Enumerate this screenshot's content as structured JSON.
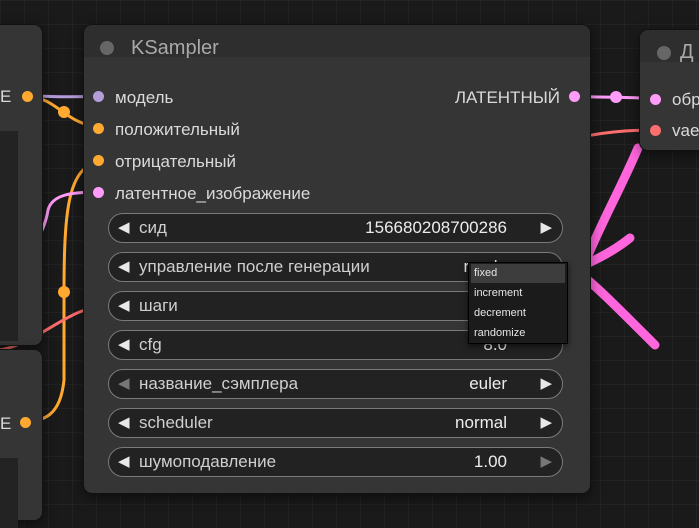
{
  "colors": {
    "canvas": "#1a1a1a",
    "model": "#b39ddb",
    "conditioning": "#ffa931",
    "latent": "#ff9cf9",
    "vae": "#ff6e6e",
    "annotation": "#ff66dd"
  },
  "left_nodes": {
    "top_output_suffix": "E",
    "bottom_output_suffix": "E"
  },
  "ksampler": {
    "title": "KSampler",
    "inputs": [
      {
        "name": "модель",
        "type": "MODEL"
      },
      {
        "name": "положительный",
        "type": "CONDITIONING"
      },
      {
        "name": "отрицательный",
        "type": "CONDITIONING"
      },
      {
        "name": "латентное_изображение",
        "type": "LATENT"
      }
    ],
    "output": {
      "name": "ЛАТЕНТНЫЙ",
      "type": "LATENT"
    },
    "widgets": [
      {
        "label": "сид",
        "value": "156680208700286"
      },
      {
        "label": "управление после генерации",
        "value": "rando"
      },
      {
        "label": "шаги",
        "value": ""
      },
      {
        "label": "cfg",
        "value": "8.0"
      },
      {
        "label": "название_сэмплера",
        "value": "euler"
      },
      {
        "label": "scheduler",
        "value": "normal"
      },
      {
        "label": "шумоподавление",
        "value": "1.00"
      }
    ]
  },
  "right_node": {
    "title": "Д",
    "inputs": [
      {
        "name": "обр",
        "type": "LATENT"
      },
      {
        "name": "vae",
        "type": "VAE"
      }
    ]
  },
  "dropdown": {
    "options": [
      "fixed",
      "increment",
      "decrement",
      "randomize"
    ],
    "selected": "fixed"
  }
}
